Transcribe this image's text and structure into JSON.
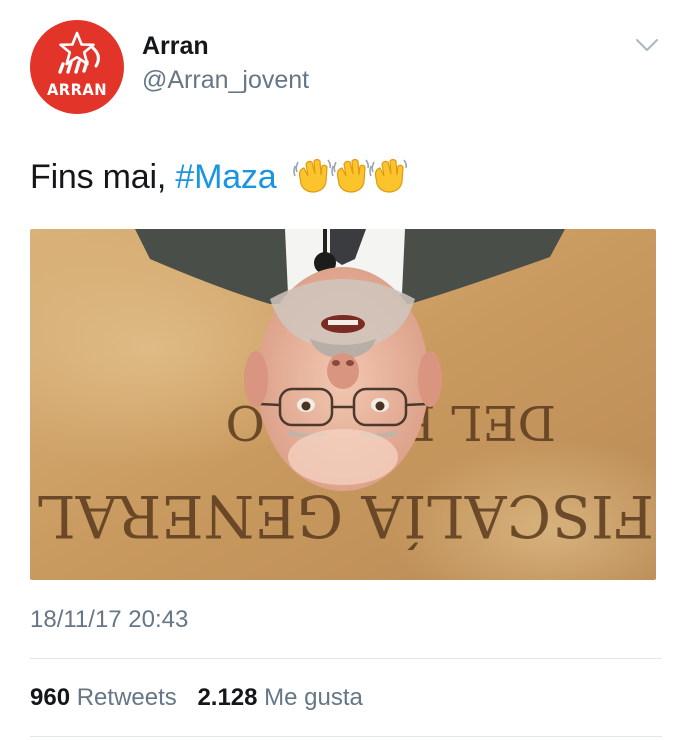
{
  "author": {
    "display_name": "Arran",
    "handle": "@Arran_jovent",
    "avatar_text": "ARRAN",
    "avatar_color": "#e3342a"
  },
  "tweet": {
    "text_prefix": "Fins mai, ",
    "hashtag": "#Maza",
    "emojis": [
      "waving-hand-icon",
      "waving-hand-icon",
      "waving-hand-icon"
    ],
    "timestamp": "18/11/17 20:43",
    "hashtag_color": "#1b95e0"
  },
  "media": {
    "sign_line_1": "DEL ESTADO",
    "sign_line_2": "FISCALÍA GENERAL",
    "orientation": "upside-down"
  },
  "stats": {
    "retweets_count": "960",
    "retweets_label": "Retweets",
    "likes_count": "2.128",
    "likes_label": "Me gusta"
  }
}
